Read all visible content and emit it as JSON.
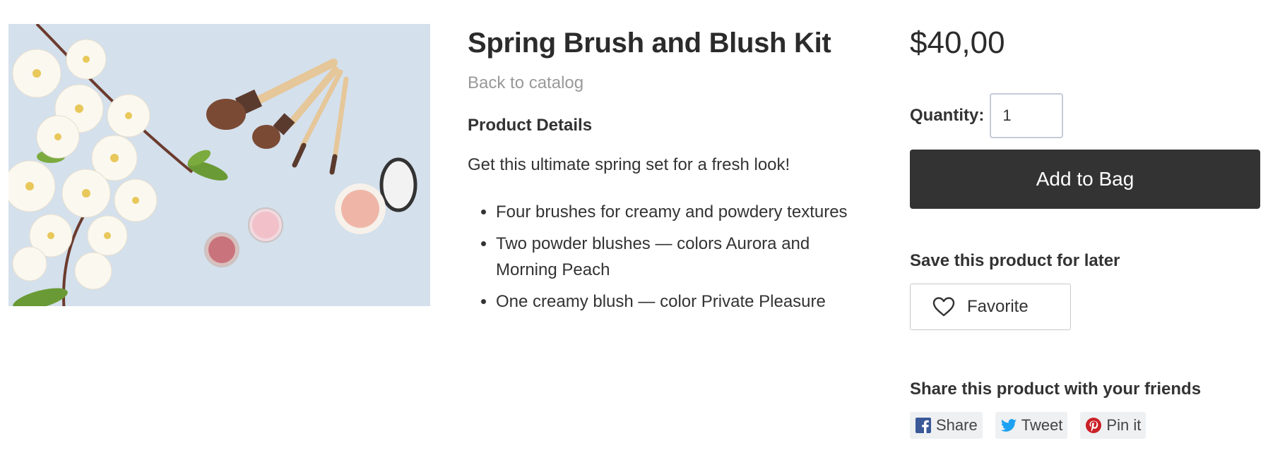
{
  "product": {
    "title": "Spring Brush and Blush Kit",
    "back_link": "Back to catalog",
    "details_heading": "Product Details",
    "intro": "Get this ultimate spring set for a fresh look!",
    "features": [
      "Four brushes for creamy and powdery textures",
      "Two powder blushes — colors Aurora and Morning Peach",
      "One creamy blush — color Private Pleasure"
    ]
  },
  "purchase": {
    "price": "$40,00",
    "quantity_label": "Quantity:",
    "quantity_value": "1",
    "add_to_bag_label": "Add to Bag"
  },
  "save": {
    "heading": "Save this product for later",
    "favorite_label": "Favorite",
    "icon": "heart-icon"
  },
  "share": {
    "heading": "Share this product with your friends",
    "buttons": [
      {
        "label": "Share",
        "icon": "facebook-icon",
        "color": "#3b5998"
      },
      {
        "label": "Tweet",
        "icon": "twitter-icon",
        "color": "#1da1f2"
      },
      {
        "label": "Pin it",
        "icon": "pinterest-icon",
        "color": "#cb2027"
      }
    ]
  },
  "colors": {
    "button_dark": "#333333",
    "image_background": "#d4e0ec"
  }
}
